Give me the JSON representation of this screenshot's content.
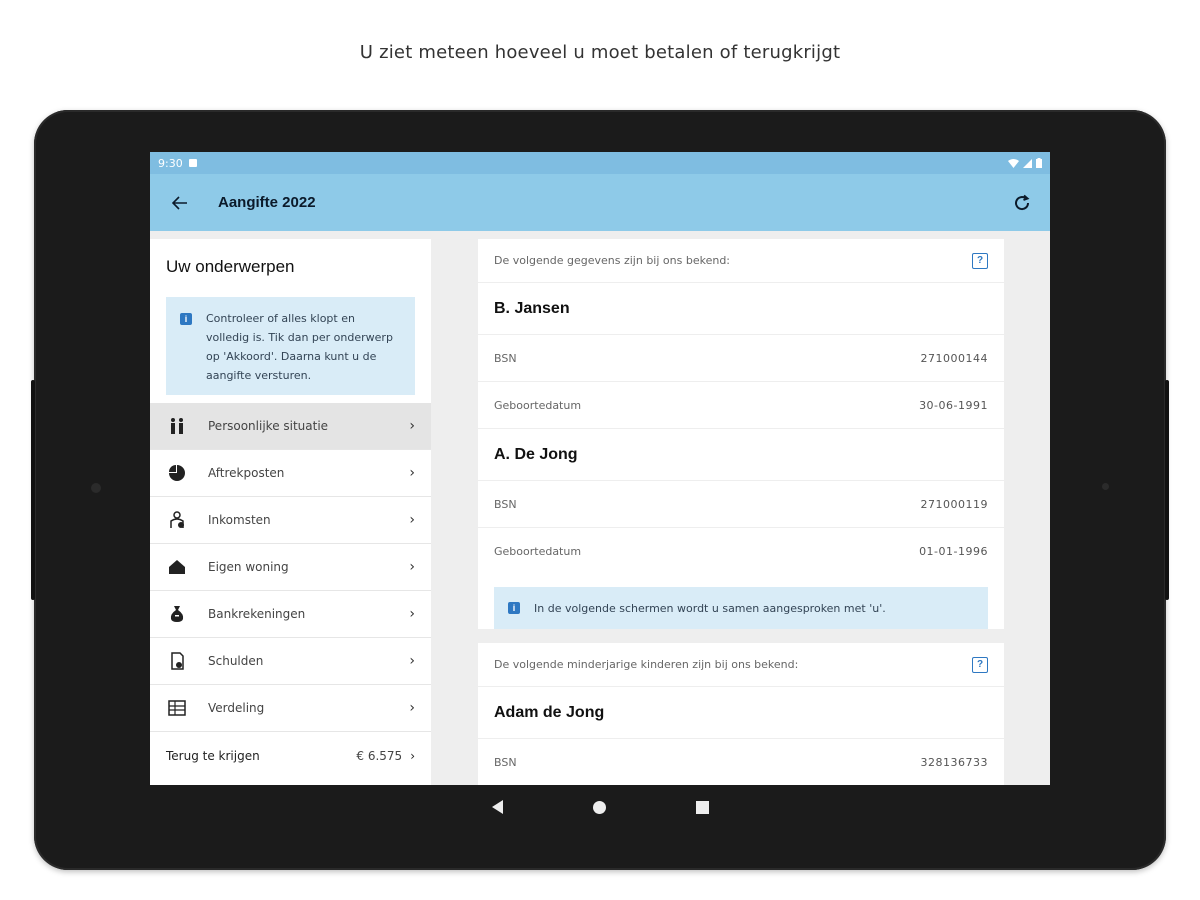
{
  "caption": "U ziet meteen hoeveel u moet betalen of terugkrijgt",
  "status_bar": {
    "time": "9:30"
  },
  "app_bar": {
    "title": "Aangifte 2022",
    "back_icon": "arrow-left-icon",
    "refresh_icon": "refresh-icon"
  },
  "sidebar": {
    "heading": "Uw onderwerpen",
    "info": "Controleer of alles klopt en volledig is. Tik dan per onderwerp op 'Akkoord'. Daarna kunt u de aangifte versturen.",
    "items": [
      {
        "label": "Persoonlijke situatie",
        "icon": "people-icon"
      },
      {
        "label": "Aftrekposten",
        "icon": "pie-chart-icon"
      },
      {
        "label": "Inkomsten",
        "icon": "coins-icon"
      },
      {
        "label": "Eigen woning",
        "icon": "house-icon"
      },
      {
        "label": "Bankrekeningen",
        "icon": "money-bag-icon"
      },
      {
        "label": "Schulden",
        "icon": "debt-icon"
      },
      {
        "label": "Verdeling",
        "icon": "distribution-icon"
      }
    ],
    "total_label": "Terug te krijgen",
    "total_amount": "€ 6.575"
  },
  "main": {
    "card1": {
      "header": "De volgende gegevens zijn bij ons bekend:",
      "help": "?",
      "persons": [
        {
          "name": "B. Jansen",
          "bsn_label": "BSN",
          "bsn": "271000144",
          "dob_label": "Geboortedatum",
          "dob": "30-06-1991"
        },
        {
          "name": "A. De Jong",
          "bsn_label": "BSN",
          "bsn": "271000119",
          "dob_label": "Geboortedatum",
          "dob": "01-01-1996"
        }
      ],
      "note": "In de volgende schermen wordt u samen aangesproken met 'u'."
    },
    "card2": {
      "header": "De volgende minderjarige kinderen zijn bij ons bekend:",
      "help": "?",
      "child_name": "Adam de Jong",
      "bsn_label": "BSN",
      "bsn": "328136733"
    }
  }
}
